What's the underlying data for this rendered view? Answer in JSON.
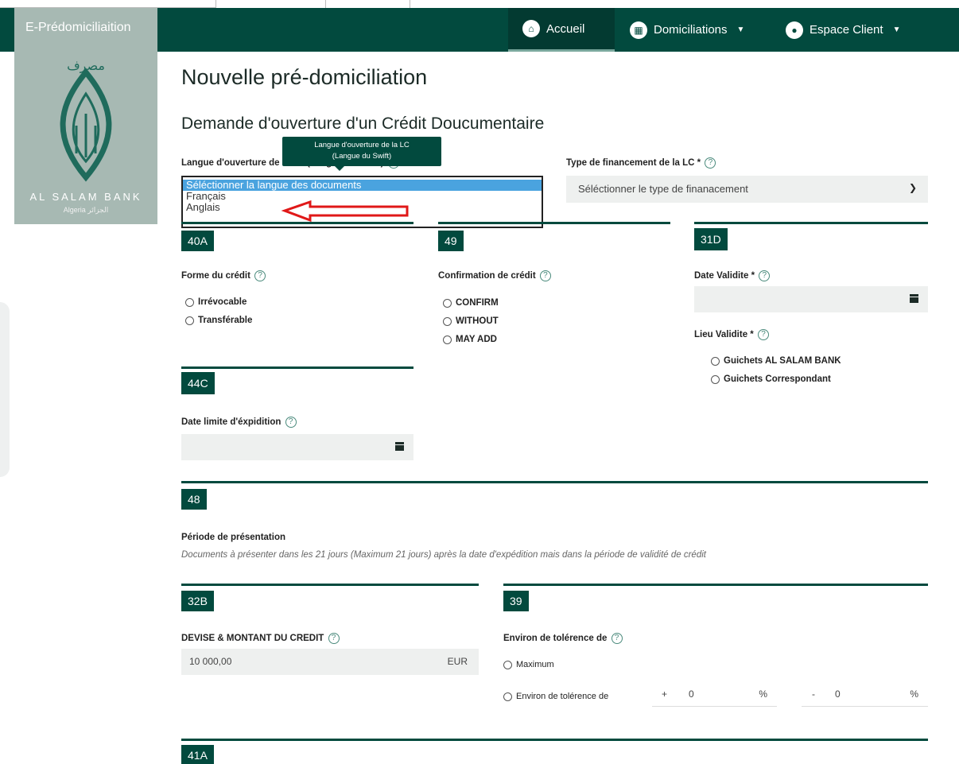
{
  "app": {
    "brand": "E-Prédomiciliaition"
  },
  "nav": {
    "home": "Accueil",
    "domiciliations": "Domiciliations",
    "client": "Espace Client"
  },
  "logo": {
    "arabic_top": "مصرف",
    "name": "AL SALAM BANK",
    "sub": "Algeria الجزائر"
  },
  "page": {
    "title": "Nouvelle pré-domiciliation",
    "section": "Demande d'ouverture d'un Crédit Doucumentaire"
  },
  "langue": {
    "label": "Langue d'ouverture de la LC (Langue du Swift)",
    "tooltip_line1": "Langue d'ouverture de la LC",
    "tooltip_line2": "(Langue du Swift)",
    "options": [
      "Séléctionner la langue des documents",
      "Français",
      "Anglais"
    ],
    "selected": "Séléctionner la langue des documents"
  },
  "financement": {
    "label": "Type de financement de la LC *",
    "placeholder": "Séléctionner le type de finanacement"
  },
  "sections": {
    "s40a": "40A",
    "s49": "49",
    "s31d": "31D",
    "s44c": "44C",
    "s48": "48",
    "s32b": "32B",
    "s39": "39",
    "s41a": "41A"
  },
  "forme": {
    "label": "Forme du crédit",
    "options": [
      "Irrévocable",
      "Transférable"
    ]
  },
  "confirmation": {
    "label": "Confirmation de crédit",
    "options": [
      "CONFIRM",
      "WITHOUT",
      "MAY ADD"
    ]
  },
  "validite": {
    "date_label": "Date Validite *",
    "lieu_label": "Lieu Validite *",
    "lieu_options": [
      "Guichets AL SALAM BANK",
      "Guichets Correspondant"
    ]
  },
  "expedition": {
    "label": "Date limite d'éxpidition"
  },
  "periode": {
    "title": "Période de présentation",
    "text": "Documents à présenter dans les 21 jours (Maximum 21 jours) après la date d'expédition mais dans la période de validité de crédit"
  },
  "montant": {
    "label": "DEVISE & MONTANT DU CREDIT",
    "value": "10 000,00",
    "currency": "EUR"
  },
  "tolerance": {
    "label": "Environ de tolérence de",
    "opt_max": "Maximum",
    "opt_env": "Environ de tolérence de",
    "plus_sign": "+",
    "plus_value": "0",
    "minus_sign": "-",
    "minus_value": "0",
    "unit": "%"
  },
  "colors": {
    "primary": "#024a3e",
    "brand_bg": "#a7b9b3",
    "annotation": "#e01818"
  }
}
